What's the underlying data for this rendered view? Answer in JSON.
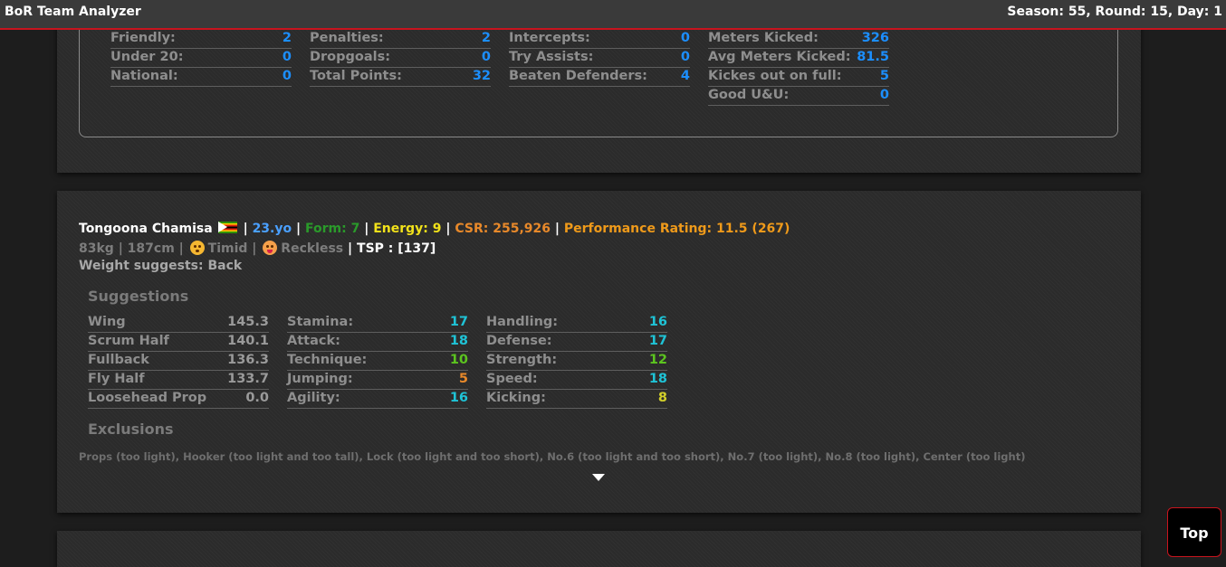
{
  "app": {
    "title": "BoR Team Analyzer",
    "season_info": "Season: 55, Round: 15, Day: 1"
  },
  "prev_stats": {
    "col1": [
      {
        "label": "Friendly:",
        "value": "2"
      },
      {
        "label": "Under 20:",
        "value": "0"
      },
      {
        "label": "National:",
        "value": "0"
      }
    ],
    "col2": [
      {
        "label": "Penalties:",
        "value": "2"
      },
      {
        "label": "Dropgoals:",
        "value": "0"
      },
      {
        "label": "Total Points:",
        "value": "32"
      }
    ],
    "col3": [
      {
        "label": "Intercepts:",
        "value": "0"
      },
      {
        "label": "Try Assists:",
        "value": "0"
      },
      {
        "label": "Beaten Defenders:",
        "value": "4"
      }
    ],
    "col4": [
      {
        "label": "Meters Kicked:",
        "value": "326"
      },
      {
        "label": "Avg Meters Kicked:",
        "value": "81.5"
      },
      {
        "label": "Kickes out on full:",
        "value": "5"
      },
      {
        "label": "Good U&U:",
        "value": "0"
      }
    ]
  },
  "player": {
    "name": "Tongoona Chamisa",
    "sep": "|",
    "age": "23.yo",
    "form": "Form: 7",
    "energy": "Energy: 9",
    "csr": "CSR: 255,926",
    "performance": "Performance Rating: 11.5 (267)",
    "weight_height": "83kg | 187cm |",
    "trait1": "Timid",
    "trait_sep": "|",
    "trait2": "Reckless",
    "tsp": "| TSP : [137]",
    "weight_suggests": "Weight suggests: Back",
    "suggestions_heading": "Suggestions",
    "suggestions": [
      {
        "label": "Wing",
        "value": "145.3"
      },
      {
        "label": "Scrum Half",
        "value": "140.1"
      },
      {
        "label": "Fullback",
        "value": "136.3"
      },
      {
        "label": "Fly Half",
        "value": "133.7"
      },
      {
        "label": "Loosehead Prop",
        "value": "0.0"
      }
    ],
    "skills1": [
      {
        "label": "Stamina:",
        "value": "17",
        "color": "#1fc3d6"
      },
      {
        "label": "Attack:",
        "value": "18",
        "color": "#1fc3d6"
      },
      {
        "label": "Technique:",
        "value": "10",
        "color": "#5cc41f"
      },
      {
        "label": "Jumping:",
        "value": "5",
        "color": "#e8892a"
      },
      {
        "label": "Agility:",
        "value": "16",
        "color": "#1fc3d6"
      }
    ],
    "skills2": [
      {
        "label": "Handling:",
        "value": "16",
        "color": "#1fc3d6"
      },
      {
        "label": "Defense:",
        "value": "17",
        "color": "#1fc3d6"
      },
      {
        "label": "Strength:",
        "value": "12",
        "color": "#5cc41f"
      },
      {
        "label": "Speed:",
        "value": "18",
        "color": "#1fc3d6"
      },
      {
        "label": "Kicking:",
        "value": "8",
        "color": "#d2cf2a"
      }
    ],
    "exclusions_heading": "Exclusions",
    "exclusions": "Props (too light), Hooker (too light and too tall), Lock (too light and too short), No.6 (too light and too short), No.7 (too light), No.8 (too light), Center (too light)"
  },
  "top_button": "Top"
}
